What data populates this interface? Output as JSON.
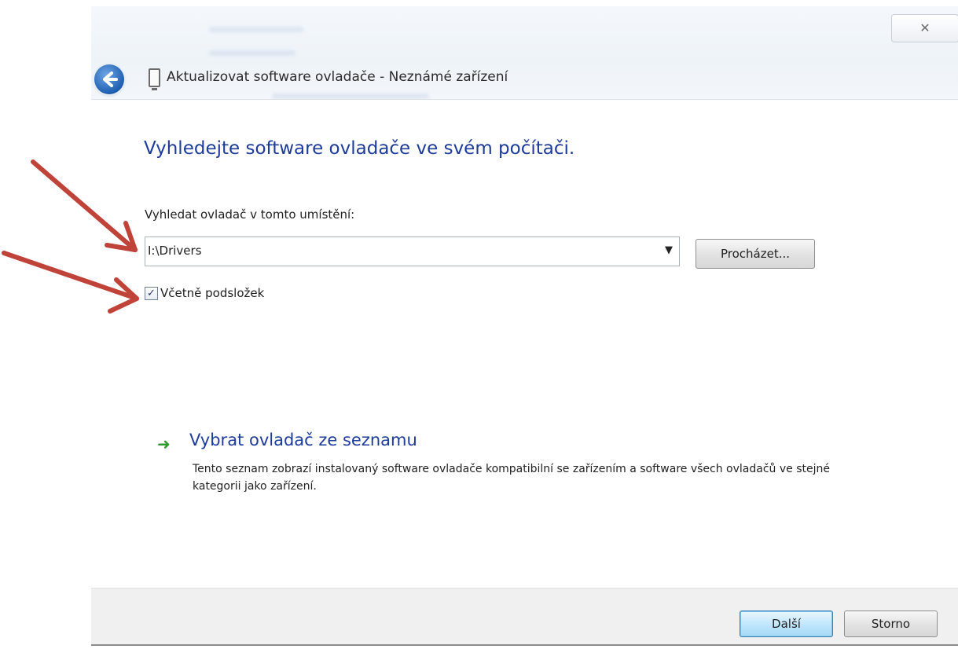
{
  "window": {
    "title": "Aktualizovat software ovladače - Neznámé zařízení",
    "close_glyph": "✕"
  },
  "main": {
    "heading": "Vyhledejte software ovladače ve svém počítači.",
    "location_label": "Vyhledat ovladač v tomto umístění:",
    "path_value": "I:\\Drivers",
    "dropdown_glyph": "▼",
    "browse_label": "Procházet...",
    "include_subfolders_label": "Včetně podsložek",
    "include_subfolders_checked": true,
    "checkmark_glyph": "✓",
    "pick_option": {
      "arrow_glyph": "➜",
      "title": "Vybrat ovladač ze seznamu",
      "description": "Tento seznam zobrazí instalovaný software ovladače kompatibilní se zařízením a software všech ovladačů ve stejné kategorii jako zařízení."
    }
  },
  "footer": {
    "next_label": "Další",
    "cancel_label": "Storno"
  },
  "colors": {
    "heading": "#1c3b9a",
    "annotation_arrow": "#c0433a",
    "option_arrow": "#2f9a2f"
  },
  "icons": {
    "back": "back-arrow-icon",
    "device": "device-icon",
    "option": "green-arrow-icon"
  }
}
